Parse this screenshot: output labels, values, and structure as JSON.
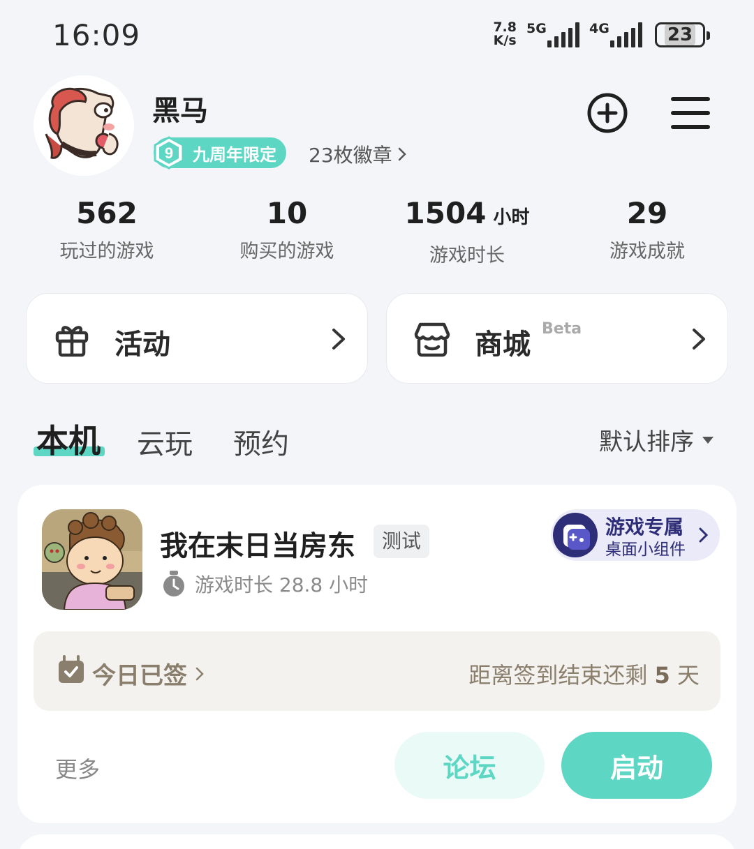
{
  "status_bar": {
    "time": "16:09",
    "net_speed_value": "7.8",
    "net_speed_unit": "K/s",
    "signal_1_label": "5G",
    "signal_2_label": "4G",
    "battery": "23"
  },
  "profile": {
    "name": "黑马",
    "badge_number": "9",
    "badge_label": "九周年限定",
    "badge_count": "23枚徽章"
  },
  "stats": [
    {
      "value": "562",
      "unit": "",
      "label": "玩过的游戏"
    },
    {
      "value": "10",
      "unit": "",
      "label": "购买的游戏"
    },
    {
      "value": "1504",
      "unit": "小时",
      "label": "游戏时长"
    },
    {
      "value": "29",
      "unit": "",
      "label": "游戏成就"
    }
  ],
  "cards": {
    "activity": "活动",
    "shop": "商城",
    "shop_tag": "Beta"
  },
  "tabs": [
    {
      "label": "本机",
      "active": true
    },
    {
      "label": "云玩",
      "active": false
    },
    {
      "label": "预约",
      "active": false
    }
  ],
  "sort": {
    "label": "默认排序"
  },
  "game": {
    "title": "我在末日当房东",
    "tag": "测试",
    "playtime": "游戏时长 28.8 小时",
    "widget_line1": "游戏专属",
    "widget_line2": "桌面小组件",
    "checkin_label": "今日已签",
    "checkin_prefix": "距离签到结束还剩 ",
    "checkin_days": "5",
    "checkin_suffix": " 天",
    "more": "更多",
    "forum_button": "论坛",
    "launch_button": "启动"
  },
  "colors": {
    "accent": "#5ed6c4",
    "background": "#f3f5f8",
    "widget_bg": "#ebeaf8",
    "checkin_text": "#8a7e6c"
  },
  "icons": {
    "add": "plus-circle-icon",
    "menu": "hamburger-menu-icon",
    "activity": "gift-icon",
    "shop": "store-icon",
    "playtime": "stopwatch-icon",
    "checkin": "calendar-check-icon",
    "widget": "gamepad-icon"
  }
}
